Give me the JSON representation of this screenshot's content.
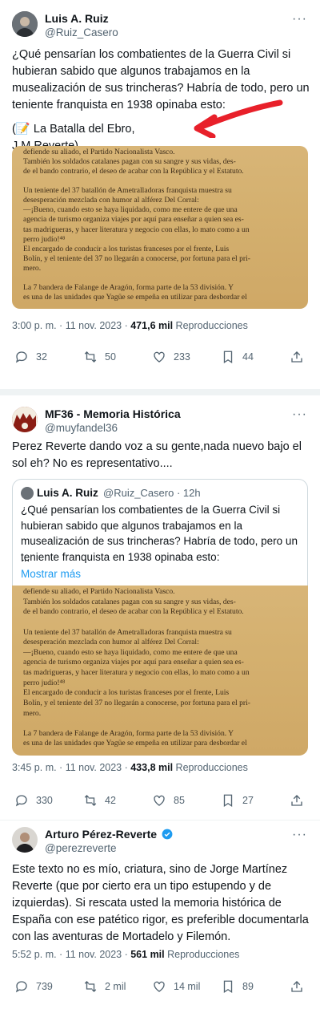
{
  "tweets": [
    {
      "name": "Luis A. Ruiz",
      "handle": "@Ruiz_Casero",
      "text": "¿Qué pensarían los combatientes de la Guerra Civil si hubieran sabido que algunos trabajamos en la musealización de sus trincheras? Habría de todo, pero un teniente franquista en 1938 opinaba esto:",
      "caption": "(📝 La Batalla del Ebro, J.M.Reverte)",
      "time": "3:00 p. m. · 11 nov. 2023 · ",
      "views": "471,6 mil",
      "views_label": " Reproducciones",
      "replies": "32",
      "retweets": "50",
      "likes": "233",
      "bookmarks": "44"
    },
    {
      "name": "MF36 - Memoria Histórica",
      "handle": "@muyfandel36",
      "text": "Perez Reverte dando voz a su gente,nada nuevo bajo el sol eh? No es representativo....",
      "quote": {
        "name": "Luis A. Ruiz",
        "handle": "@Ruiz_Casero · 12h",
        "text": "¿Qué pensarían los combatientes de la Guerra Civil si hubieran sabido que algunos trabajamos en la musealización de sus trincheras? Habría de todo, pero un teniente franquista en 1938 opinaba esto:",
        "ellipsis": "...",
        "more": "Mostrar más"
      },
      "time": "3:45 p. m. · 11 nov. 2023 · ",
      "views": "433,8 mil",
      "views_label": " Reproducciones",
      "replies": "330",
      "retweets": "42",
      "likes": "85",
      "bookmarks": "27"
    },
    {
      "name": "Arturo Pérez-Reverte",
      "handle": "@perezreverte",
      "text": "Este texto no es mío, criatura, sino de Jorge Martínez Reverte (que por cierto era un tipo estupendo y de izquierdas). Si rescata usted la memoria histórica de España con ese patético rigor, es preferible documentarla con las aventuras de Mortadelo y Filemón.",
      "time": "5:52 p. m. · 11 nov. 2023 · ",
      "views": "561 mil",
      "views_label": " Reproducciones",
      "replies": "739",
      "retweets": "2 mil",
      "likes": "14 mil",
      "bookmarks": "89"
    }
  ],
  "book_page": [
    "defiende su aliado, el Partido Nacionalista Vasco.",
    "   También los soldados catalanes pagan con su sangre y sus vidas, des-",
    "de el bando contrario, el deseo de acabar con la República y el Estatuto.",
    "",
    "   Un teniente del 37 batallón de Ametralladoras franquista muestra su",
    "desesperación mezclada con humor al alférez Del Corral:",
    "   —¡Bueno, cuando esto se haya liquidado, como me entere de que una",
    "agencia de turismo organiza viajes por aquí para enseñar a quien sea es-",
    "tas madrigueras, y hacer literatura y negocio con ellas, lo mato como a un",
    "perro judío!⁴⁸",
    "   El encargado de conducir a los turistas franceses por el frente, Luis",
    "Bolín, y el teniente del 37 no llegarán a conocerse, por fortuna para el pri-",
    "mero.",
    "",
    "   La 7 bandera de Falange de Aragón, forma parte de la 53 división. Y",
    "es una de las unidades que Yagüe se empeña en utilizar para desbordar el"
  ],
  "colors": {
    "accent": "#1d9bf0",
    "arrow": "#e8202a",
    "verified": "#1d9bf0"
  },
  "icons": [
    "reply-icon",
    "retweet-icon",
    "like-icon",
    "bookmark-icon",
    "share-icon",
    "more-icon",
    "verified-badge-icon",
    "memo-icon"
  ]
}
